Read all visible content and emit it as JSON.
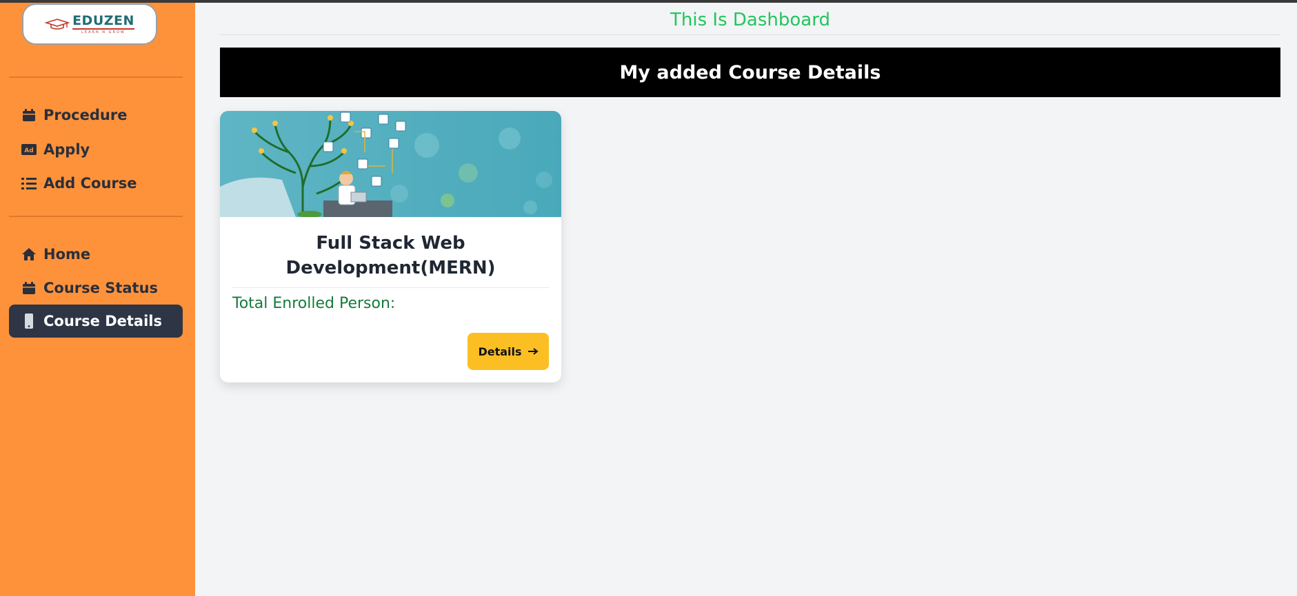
{
  "brand": {
    "name": "EDUZEN",
    "tagline": "LEARN N GROW"
  },
  "sidebar": {
    "group1": [
      {
        "label": "Procedure",
        "icon": "calendar-icon"
      },
      {
        "label": "Apply",
        "icon": "ad-icon"
      },
      {
        "label": "Add Course",
        "icon": "list-icon"
      }
    ],
    "group2": [
      {
        "label": "Home",
        "icon": "home-icon"
      },
      {
        "label": "Course Status",
        "icon": "calendar-icon"
      },
      {
        "label": "Course Details",
        "icon": "mobile-icon",
        "active": true
      }
    ]
  },
  "main": {
    "title": "This Is Dashboard",
    "banner": "My added Course Details",
    "courses": [
      {
        "title": "Full Stack Web Development(MERN)",
        "enrolled_label": "Total Enrolled Person:",
        "button_label": "Details",
        "button_icon": "arrow-right-icon"
      }
    ]
  },
  "colors": {
    "sidebar_bg": "#fe923b",
    "active_item_bg": "#2e3646",
    "title_green": "#22c55e",
    "button_yellow": "#fbbf24",
    "enrolled_green": "#157a3a"
  }
}
